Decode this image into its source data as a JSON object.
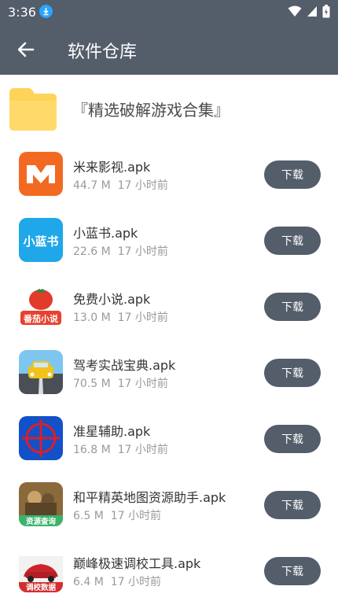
{
  "status_bar": {
    "time": "3:36"
  },
  "app_bar": {
    "title": "软件仓库"
  },
  "folder": {
    "name": "『精选破解游戏合集』"
  },
  "apps": [
    {
      "name": "米来影视.apk",
      "size": "44.7 M",
      "time": "17 小时前",
      "button": "下载"
    },
    {
      "name": "小蓝书.apk",
      "size": "22.6 M",
      "time": "17 小时前",
      "button": "下载",
      "icon_text": "小蓝书"
    },
    {
      "name": "免费小说.apk",
      "size": "13.0 M",
      "time": "17 小时前",
      "button": "下载",
      "icon_text": "番茄小说"
    },
    {
      "name": "驾考实战宝典.apk",
      "size": "70.5 M",
      "time": "17 小时前",
      "button": "下载"
    },
    {
      "name": "准星辅助.apk",
      "size": "16.8 M",
      "time": "17 小时前",
      "button": "下载"
    },
    {
      "name": "和平精英地图资源助手.apk",
      "size": "6.5 M",
      "time": "17 小时前",
      "button": "下载",
      "icon_text": "资源查询"
    },
    {
      "name": "巅峰极速调校工具.apk",
      "size": "6.4 M",
      "time": "17 小时前",
      "button": "下载",
      "icon_text": "调校数据"
    }
  ],
  "colors": {
    "bar": "#545d6a",
    "button": "#545d6a",
    "folder": "#ffd35a"
  }
}
